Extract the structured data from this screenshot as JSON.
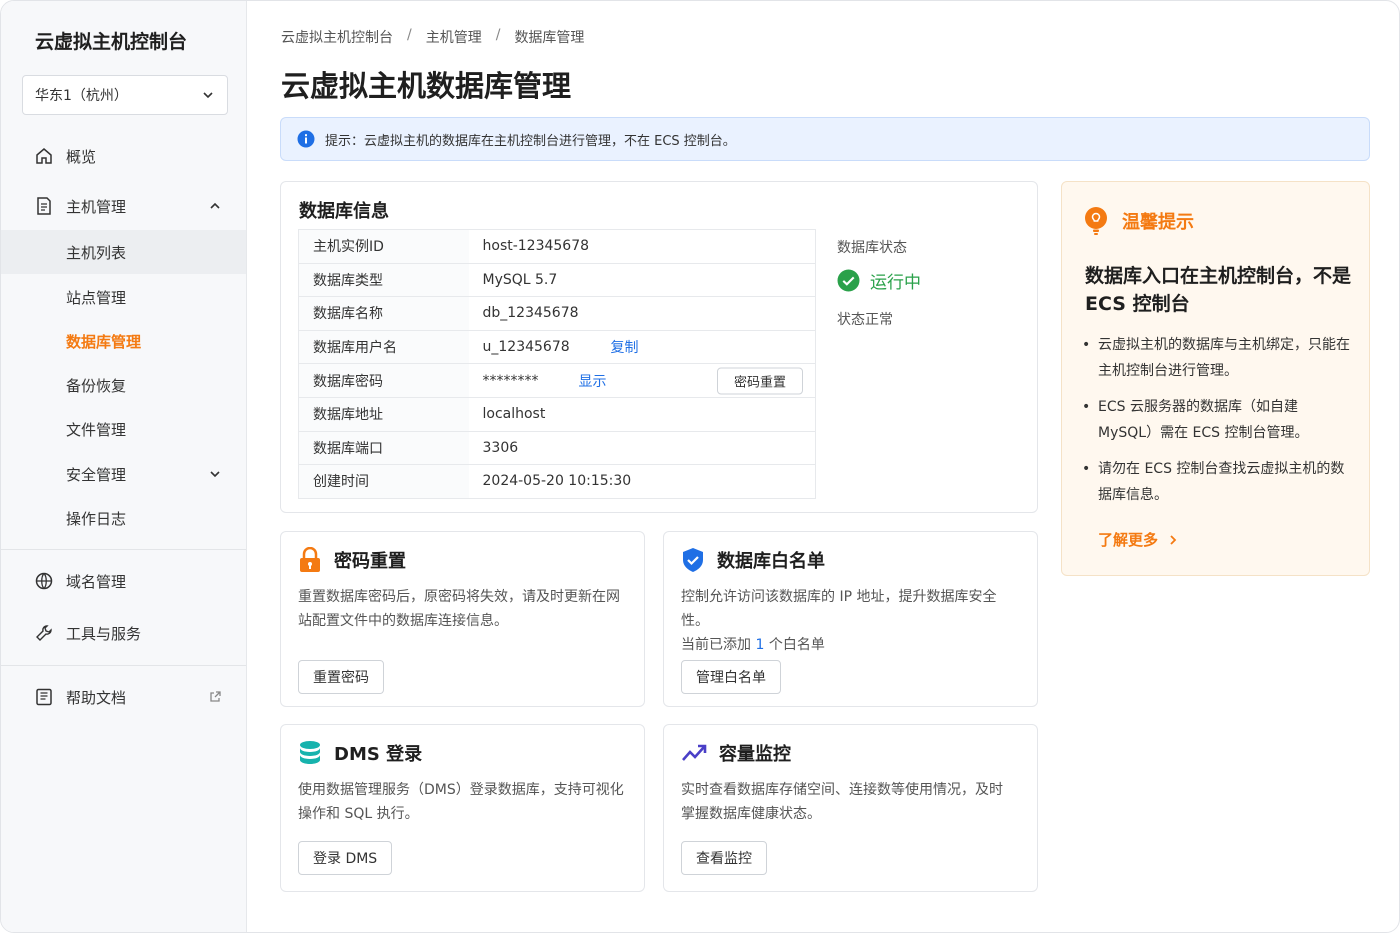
{
  "sidebar": {
    "brand": "云虚拟主机控制台",
    "region": "华东1（杭州）",
    "overview": "概览",
    "host_mgmt": "主机管理",
    "sub": [
      "主机列表",
      "站点管理",
      "数据库管理",
      "备份恢复",
      "文件管理",
      "安全管理",
      "操作日志"
    ],
    "domain": "域名管理",
    "tools": "工具与服务",
    "help": "帮助文档"
  },
  "breadcrumb": [
    "云虚拟主机控制台",
    "主机管理",
    "数据库管理"
  ],
  "page_title": "云虚拟主机数据库管理",
  "notice": "提示：云虚拟主机的数据库在主机控制台进行管理，不在 ECS 控制台。",
  "db_info": {
    "title": "数据库信息",
    "rows": [
      {
        "k": "主机实例ID",
        "v": "host-12345678"
      },
      {
        "k": "数据库类型",
        "v": "MySQL 5.7"
      },
      {
        "k": "数据库名称",
        "v": "db_12345678"
      },
      {
        "k": "数据库用户名",
        "v": "u_12345678"
      },
      {
        "k": "数据库密码",
        "v": "********"
      },
      {
        "k": "数据库地址",
        "v": "localhost"
      },
      {
        "k": "数据库端口",
        "v": "3306"
      },
      {
        "k": "创建时间",
        "v": "2024-05-20 10:15:30"
      }
    ],
    "copy_label": "复制",
    "show_label": "显示",
    "reset_label": "密码重置",
    "status_label": "数据库状态",
    "status_value": "运行中",
    "status_note": "状态正常"
  },
  "tip": {
    "title": "温馨提示",
    "main": "数据库入口在主机控制台，不是 ECS 控制台",
    "items": [
      "云虚拟主机的数据库与主机绑定，只能在主机控制台进行管理。",
      "ECS 云服务器的数据库（如自建 MySQL）需在 ECS 控制台管理。",
      "请勿在 ECS 控制台查找云虚拟主机的数据库信息。"
    ],
    "more": "了解更多"
  },
  "cards": {
    "reset": {
      "title": "密码重置",
      "desc": "重置数据库密码后，原密码将失效，请及时更新在网站配置文件中的数据库连接信息。",
      "button": "重置密码"
    },
    "whitelist": {
      "title": "数据库白名单",
      "desc": "控制允许访问该数据库的 IP 地址，提升数据库安全性。",
      "count_prefix": "当前已添加",
      "count": "1",
      "count_suffix": "个白名单",
      "button": "管理白名单"
    },
    "dms": {
      "title": "DMS 登录",
      "desc": "使用数据管理服务（DMS）登录数据库，支持可视化操作和 SQL 执行。",
      "button": "登录 DMS"
    },
    "monitor": {
      "title": "容量监控",
      "desc": "实时查看数据库存储空间、连接数等使用情况，及时掌握数据库健康状态。",
      "button": "查看监控"
    }
  },
  "colors": {
    "accent": "#f47a12",
    "link": "#1f6fe5",
    "success": "#2aa14a"
  }
}
